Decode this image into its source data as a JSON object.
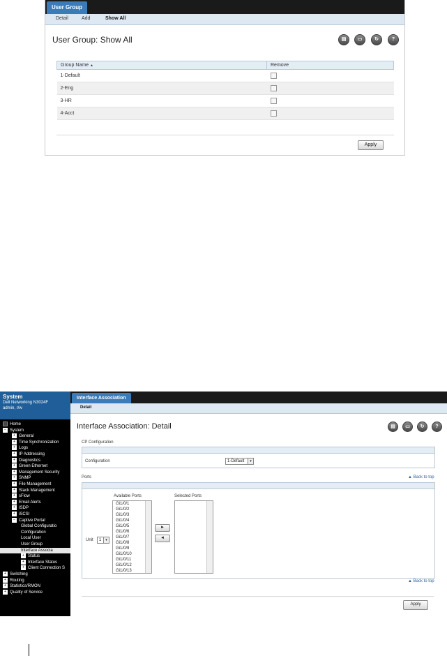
{
  "user_group": {
    "tab": "User Group",
    "subtabs": [
      "Detail",
      "Add",
      "Show All"
    ],
    "title": "User Group: Show All",
    "toolbar_icons": [
      "save-icon",
      "print-icon",
      "refresh-icon",
      "help-icon"
    ],
    "columns": [
      "Group Name",
      "Remove"
    ],
    "sort_indicator": "▲",
    "rows": [
      "1-Default",
      "2-Eng",
      "3-HR",
      "4-Acct"
    ],
    "apply_label": "Apply"
  },
  "interface_assoc": {
    "sidebar": {
      "header": [
        "System",
        "Dell Networking N3024F",
        "admin, r/w"
      ],
      "items": [
        {
          "label": "Home",
          "box": "",
          "indent": 0
        },
        {
          "label": "System",
          "box": "−",
          "indent": 0
        },
        {
          "label": "General",
          "box": "+",
          "indent": 1
        },
        {
          "label": "Time Synchronization",
          "box": "+",
          "indent": 1
        },
        {
          "label": "Logs",
          "box": "+",
          "indent": 1
        },
        {
          "label": "IP Addressing",
          "box": "+",
          "indent": 1
        },
        {
          "label": "Diagnostics",
          "box": "+",
          "indent": 1
        },
        {
          "label": "Green Ethernet",
          "box": "+",
          "indent": 1
        },
        {
          "label": "Management Security",
          "box": "+",
          "indent": 1
        },
        {
          "label": "SNMP",
          "box": "+",
          "indent": 1
        },
        {
          "label": "File Management",
          "box": "+",
          "indent": 1
        },
        {
          "label": "Stack Management",
          "box": "+",
          "indent": 1
        },
        {
          "label": "sFlow",
          "box": "+",
          "indent": 1
        },
        {
          "label": "Email Alerts",
          "box": "+",
          "indent": 1
        },
        {
          "label": "ISDP",
          "box": "+",
          "indent": 1
        },
        {
          "label": "iSCSI",
          "box": "+",
          "indent": 1
        },
        {
          "label": "Captive Portal",
          "box": "−",
          "indent": 1
        },
        {
          "label": "Global Configuratio",
          "box": "",
          "indent": 2
        },
        {
          "label": "Configuration",
          "box": "",
          "indent": 2
        },
        {
          "label": "Local User",
          "box": "",
          "indent": 2
        },
        {
          "label": "User Group",
          "box": "",
          "indent": 2
        },
        {
          "label": "Interface Associa",
          "box": "",
          "indent": 2,
          "selected": true
        },
        {
          "label": "Status",
          "box": "+",
          "indent": 2
        },
        {
          "label": "Interface Status",
          "box": "+",
          "indent": 2
        },
        {
          "label": "Client Connection S",
          "box": "+",
          "indent": 2
        },
        {
          "label": "Switching",
          "box": "+",
          "indent": 0
        },
        {
          "label": "Routing",
          "box": "+",
          "indent": 0
        },
        {
          "label": "Statistics/RMON",
          "box": "+",
          "indent": 0
        },
        {
          "label": "Quality of Service",
          "box": "+",
          "indent": 0
        }
      ]
    },
    "tab": "Interface Association",
    "subtab": "Detail",
    "title": "Interface Association: Detail",
    "cp_config_label": "CP Configuration",
    "configuration_label": "Configuration",
    "configuration_value": "1-Default",
    "ports_label": "Ports",
    "back_to_top": "▲ Back to top",
    "available_ports_label": "Available Ports",
    "selected_ports_label": "Selected Ports",
    "unit_label": "Unit",
    "unit_value": "1",
    "available_ports": [
      "Gi1/0/1",
      "Gi1/0/2",
      "Gi1/0/3",
      "Gi1/0/4",
      "Gi1/0/5",
      "Gi1/0/6",
      "Gi1/0/7",
      "Gi1/0/8",
      "Gi1/0/9",
      "Gi1/0/10",
      "Gi1/0/11",
      "Gi1/0/12",
      "Gi1/0/13"
    ],
    "move_right": "►",
    "move_left": "◄",
    "apply_label": "Apply"
  }
}
